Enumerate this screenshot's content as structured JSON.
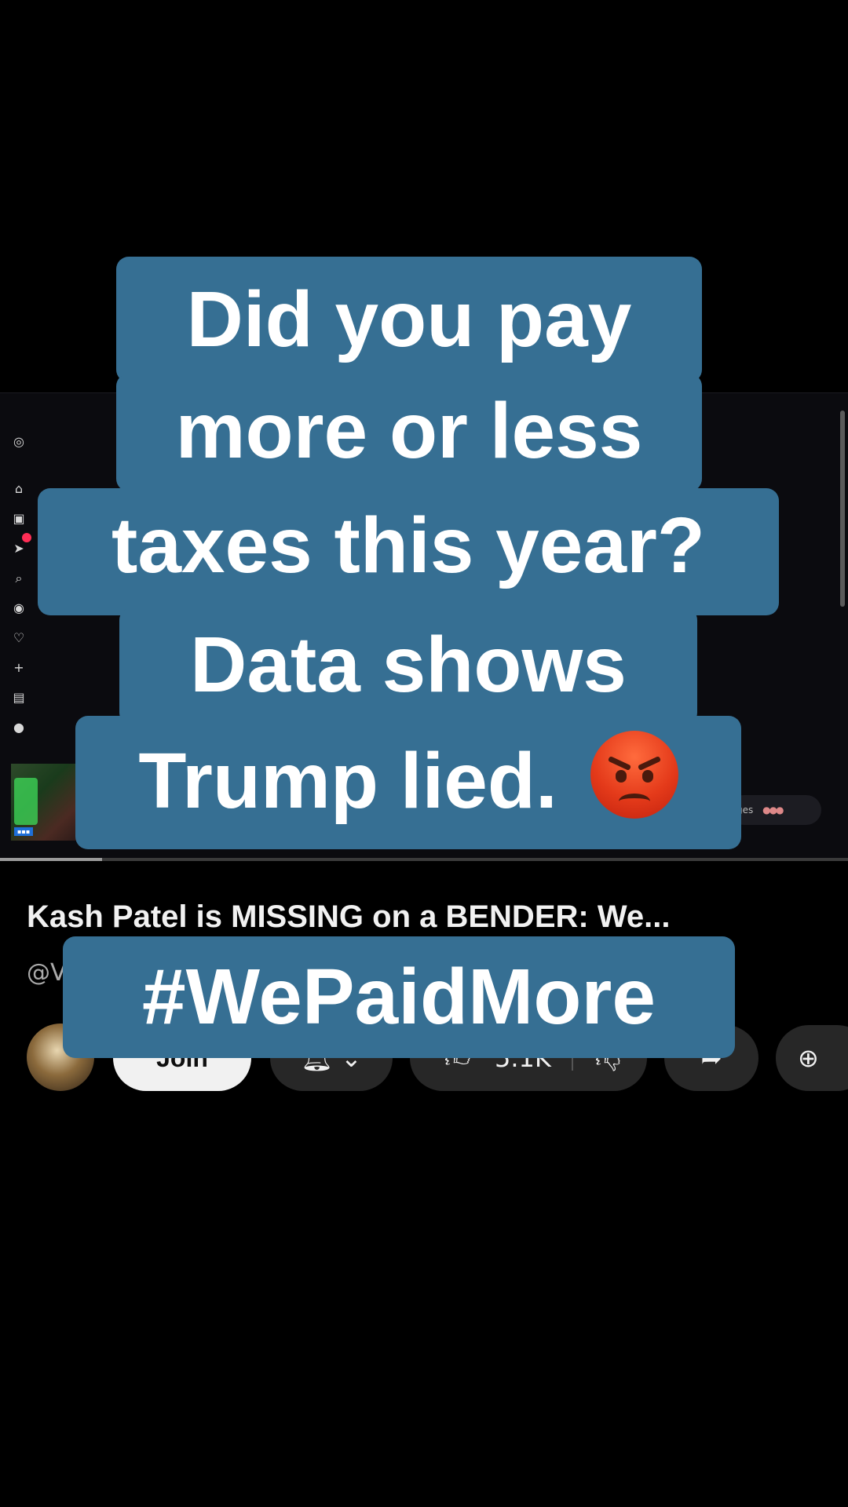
{
  "caption": {
    "lines": [
      "Did you pay",
      "more or less",
      "taxes this year?",
      "Data shows",
      "Trump lied."
    ],
    "emoji": "angry-face",
    "hashtag": "#WePaidMore",
    "background_color": "#366f93"
  },
  "recording": {
    "sidebar_icons": [
      "instagram-icon",
      "home-icon",
      "reels-icon",
      "messages-icon",
      "search-icon",
      "explore-icon",
      "heart-icon",
      "plus-icon",
      "stats-icon",
      "profile-icon"
    ],
    "right_pill_text": "ges",
    "progress": 0.12
  },
  "video": {
    "title": "Kash Patel is MISSING on a BENDER: We...",
    "channel_handle": "@V",
    "join_label": "Join",
    "like_count": "5.1K"
  }
}
